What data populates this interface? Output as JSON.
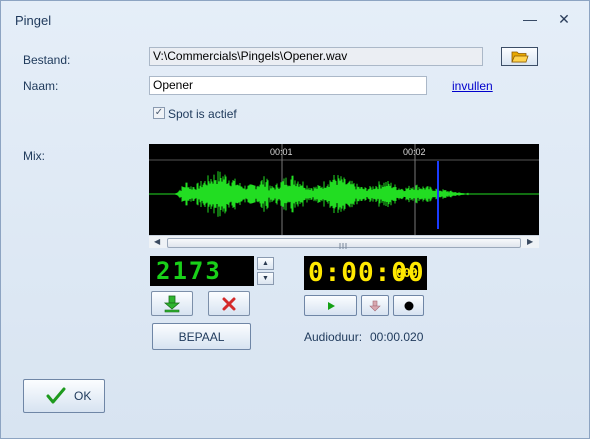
{
  "window": {
    "title": "Pingel"
  },
  "labels": {
    "bestand": "Bestand:",
    "naam": "Naam:",
    "mix": "Mix:",
    "spot": "Spot is actief",
    "invullen": "invullen",
    "audioduur": "Audioduur:"
  },
  "fields": {
    "bestand_value": "V:\\Commercials\\Pingels\\Opener.wav",
    "naam_value": "Opener"
  },
  "checkbox": {
    "spot_checked": true
  },
  "waveform": {
    "time_markers": [
      "00:01",
      "00:02"
    ],
    "wave_color": "#22dd22",
    "playhead_color": "#1a3cff"
  },
  "counter": {
    "value": "2173",
    "color": "#19d019"
  },
  "timer": {
    "value": "0:00:00",
    "ms": "000",
    "color": "#ffe800"
  },
  "audio": {
    "duration": "00:00.020"
  },
  "buttons": {
    "bepaal": "BEPAAL",
    "ok": "OK"
  },
  "icons": {
    "folder": "folder-icon",
    "download": "arrow-down-icon",
    "delete": "x-icon",
    "play": "play-icon",
    "down": "arrow-down-icon",
    "record": "record-icon",
    "ok": "checkmark-icon"
  }
}
